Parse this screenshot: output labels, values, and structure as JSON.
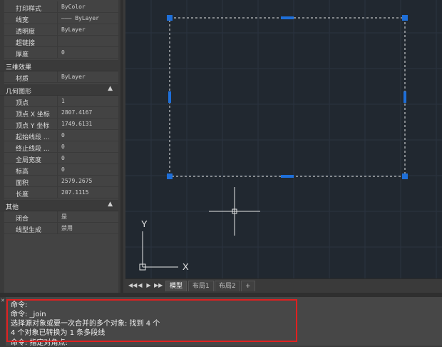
{
  "properties": {
    "rows_top": [
      {
        "key": "打印样式",
        "value": "ByColor"
      },
      {
        "key": "线宽",
        "value": "——— ByLayer"
      },
      {
        "key": "透明度",
        "value": "ByLayer"
      },
      {
        "key": "超链接",
        "value": ""
      },
      {
        "key": "厚度",
        "value": "0"
      }
    ],
    "section_3d": {
      "title": "三维效果",
      "rows": [
        {
          "key": "材质",
          "value": "ByLayer"
        }
      ]
    },
    "section_geometry": {
      "title": "几何图形",
      "rows": [
        {
          "key": "顶点",
          "value": "1"
        },
        {
          "key": "顶点 X 坐标",
          "value": "2807.4167"
        },
        {
          "key": "顶点 Y 坐标",
          "value": "1749.6131"
        },
        {
          "key": "起始线段 ...",
          "value": "0"
        },
        {
          "key": "终止线段 ...",
          "value": "0"
        },
        {
          "key": "全局宽度",
          "value": "0"
        },
        {
          "key": "标高",
          "value": "0"
        },
        {
          "key": "面积",
          "value": "2579.2675"
        },
        {
          "key": "长度",
          "value": "207.1115"
        }
      ]
    },
    "section_misc": {
      "title": "其他",
      "rows": [
        {
          "key": "闭合",
          "value": "是"
        },
        {
          "key": "线型生成",
          "value": "禁用"
        }
      ]
    },
    "collapse_glyph": "▲"
  },
  "viewport": {
    "ucs_y_label": "Y",
    "ucs_x_label": "X",
    "grid_color": "#2a3340",
    "selection_color": "#1e6fd9",
    "background_color": "#212830"
  },
  "layout_tabs": {
    "nav": [
      "◀◀",
      "◀",
      "▶",
      "▶▶"
    ],
    "tabs": [
      {
        "label": "模型",
        "active": true
      },
      {
        "label": "布局1",
        "active": false
      },
      {
        "label": "布局2",
        "active": false
      },
      {
        "label": "+",
        "active": false
      }
    ]
  },
  "command_line": {
    "close_glyph": "✕",
    "lines": [
      "命令:",
      "命令: _join",
      "选择源对象或要一次合并的多个对象: 找到 4 个",
      "4 个对象已转换为 1 条多段线",
      "命令: 指定对角点:"
    ],
    "highlight_color": "#e02020"
  }
}
